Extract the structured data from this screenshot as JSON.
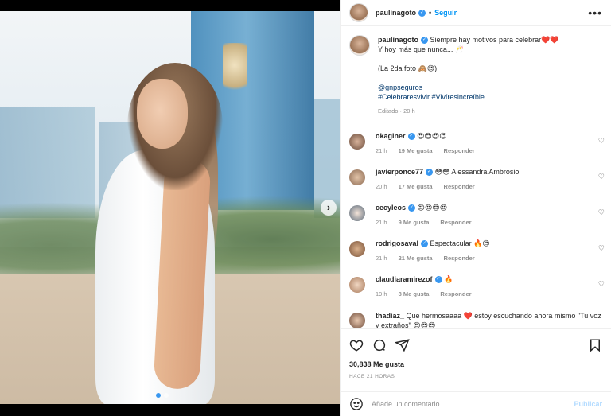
{
  "post": {
    "username": "paulinagoto",
    "follow_label": "Seguir",
    "more_label": "•••",
    "caption_lines": [
      "Siempre hay motivos para celebrar❤️❤️",
      "Y hoy más que nunca... 🥂",
      "",
      "(La 2da foto 🙈😍)",
      ""
    ],
    "mention": "@gnpseguros",
    "hashtags": "#Celebraresvivir #Vivíresincreíble",
    "edited": "Editado · 20 h"
  },
  "comments": [
    {
      "user": "okaginer",
      "text": "😍😍😍😍",
      "time": "21 h",
      "likes": "19 Me gusta",
      "reply": "Responder"
    },
    {
      "user": "javierponce77",
      "text": "😳😳 Alessandra Ambrosio",
      "time": "20 h",
      "likes": "17 Me gusta",
      "reply": "Responder"
    },
    {
      "user": "cecyleos",
      "text": "😍😍😍😍",
      "time": "21 h",
      "likes": "9 Me gusta",
      "reply": "Responder"
    },
    {
      "user": "rodrigosaval",
      "text": "Espectacular 🔥😍",
      "time": "21 h",
      "likes": "21 Me gusta",
      "reply": "Responder"
    },
    {
      "user": "claudiaramirezof",
      "text": "🔥",
      "time": "19 h",
      "likes": "8 Me gusta",
      "reply": "Responder"
    },
    {
      "user": "thadiaz_",
      "text": "Que hermosaaaa ❤️ estoy escuchando ahora mismo \"Tu voz y extraños\" 😍😍😍",
      "time": "",
      "likes": "",
      "reply": ""
    }
  ],
  "stats": {
    "likes": "30,838 Me gusta",
    "time_ago": "HACE 21 HORAS"
  },
  "comment_box": {
    "placeholder": "Añade un comentario...",
    "publish_label": "Publicar"
  },
  "colors": {
    "accent": "#0095f6",
    "verified": "#3897f0",
    "publish_disabled": "#b3dbff"
  }
}
